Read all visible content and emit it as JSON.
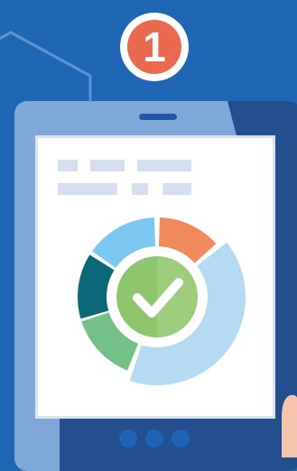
{
  "step": {
    "number": "1"
  },
  "colors": {
    "background": "#1f67b4",
    "badge": "#ea6a4f",
    "tablet_frame": "#7fa7d8",
    "screen": "#ffffff",
    "text_placeholder": "#d5dff0"
  },
  "donut_segments": [
    {
      "name": "orange",
      "color": "#f08a5d"
    },
    {
      "name": "light-blue",
      "color": "#b5dbf2"
    },
    {
      "name": "green",
      "color": "#74c188"
    },
    {
      "name": "teal",
      "color": "#0b6878"
    },
    {
      "name": "sky-blue",
      "color": "#7cc8f1"
    }
  ],
  "center_icon": "checkmark-icon"
}
